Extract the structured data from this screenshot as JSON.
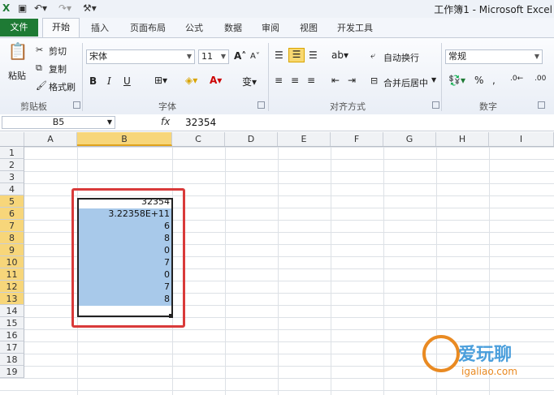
{
  "window": {
    "title": "工作簿1 - Microsoft Excel"
  },
  "tabs": [
    {
      "label": "文件"
    },
    {
      "label": "开始"
    },
    {
      "label": "插入"
    },
    {
      "label": "页面布局"
    },
    {
      "label": "公式"
    },
    {
      "label": "数据"
    },
    {
      "label": "审阅"
    },
    {
      "label": "视图"
    },
    {
      "label": "开发工具"
    }
  ],
  "ribbon": {
    "clipboard": {
      "paste": "粘贴",
      "cut": "剪切",
      "copy": "复制",
      "format_painter": "格式刷",
      "label": "剪贴板"
    },
    "font": {
      "name": "宋体",
      "size": "11",
      "bold": "B",
      "italic": "I",
      "underline": "U",
      "label": "字体"
    },
    "alignment": {
      "wrap": "自动换行",
      "merge": "合并后居中",
      "label": "对齐方式"
    },
    "number": {
      "format": "常规",
      "percent": "%",
      "label": "数字"
    }
  },
  "formula_bar": {
    "name_box": "B5",
    "fx": "fx",
    "value": "32354"
  },
  "columns": [
    "A",
    "B",
    "C",
    "D",
    "E",
    "F",
    "G",
    "H",
    "I"
  ],
  "rows": [
    "1",
    "2",
    "3",
    "4",
    "5",
    "6",
    "7",
    "8",
    "9",
    "10",
    "11",
    "12",
    "13",
    "14",
    "15",
    "16",
    "17",
    "18",
    "19"
  ],
  "cells_b": [
    "32354",
    "3.22358E+11",
    "6",
    "8",
    "0",
    "7",
    "0",
    "7",
    "8"
  ],
  "watermark": {
    "text": "爱玩聊",
    "url": "igaliao.com"
  }
}
